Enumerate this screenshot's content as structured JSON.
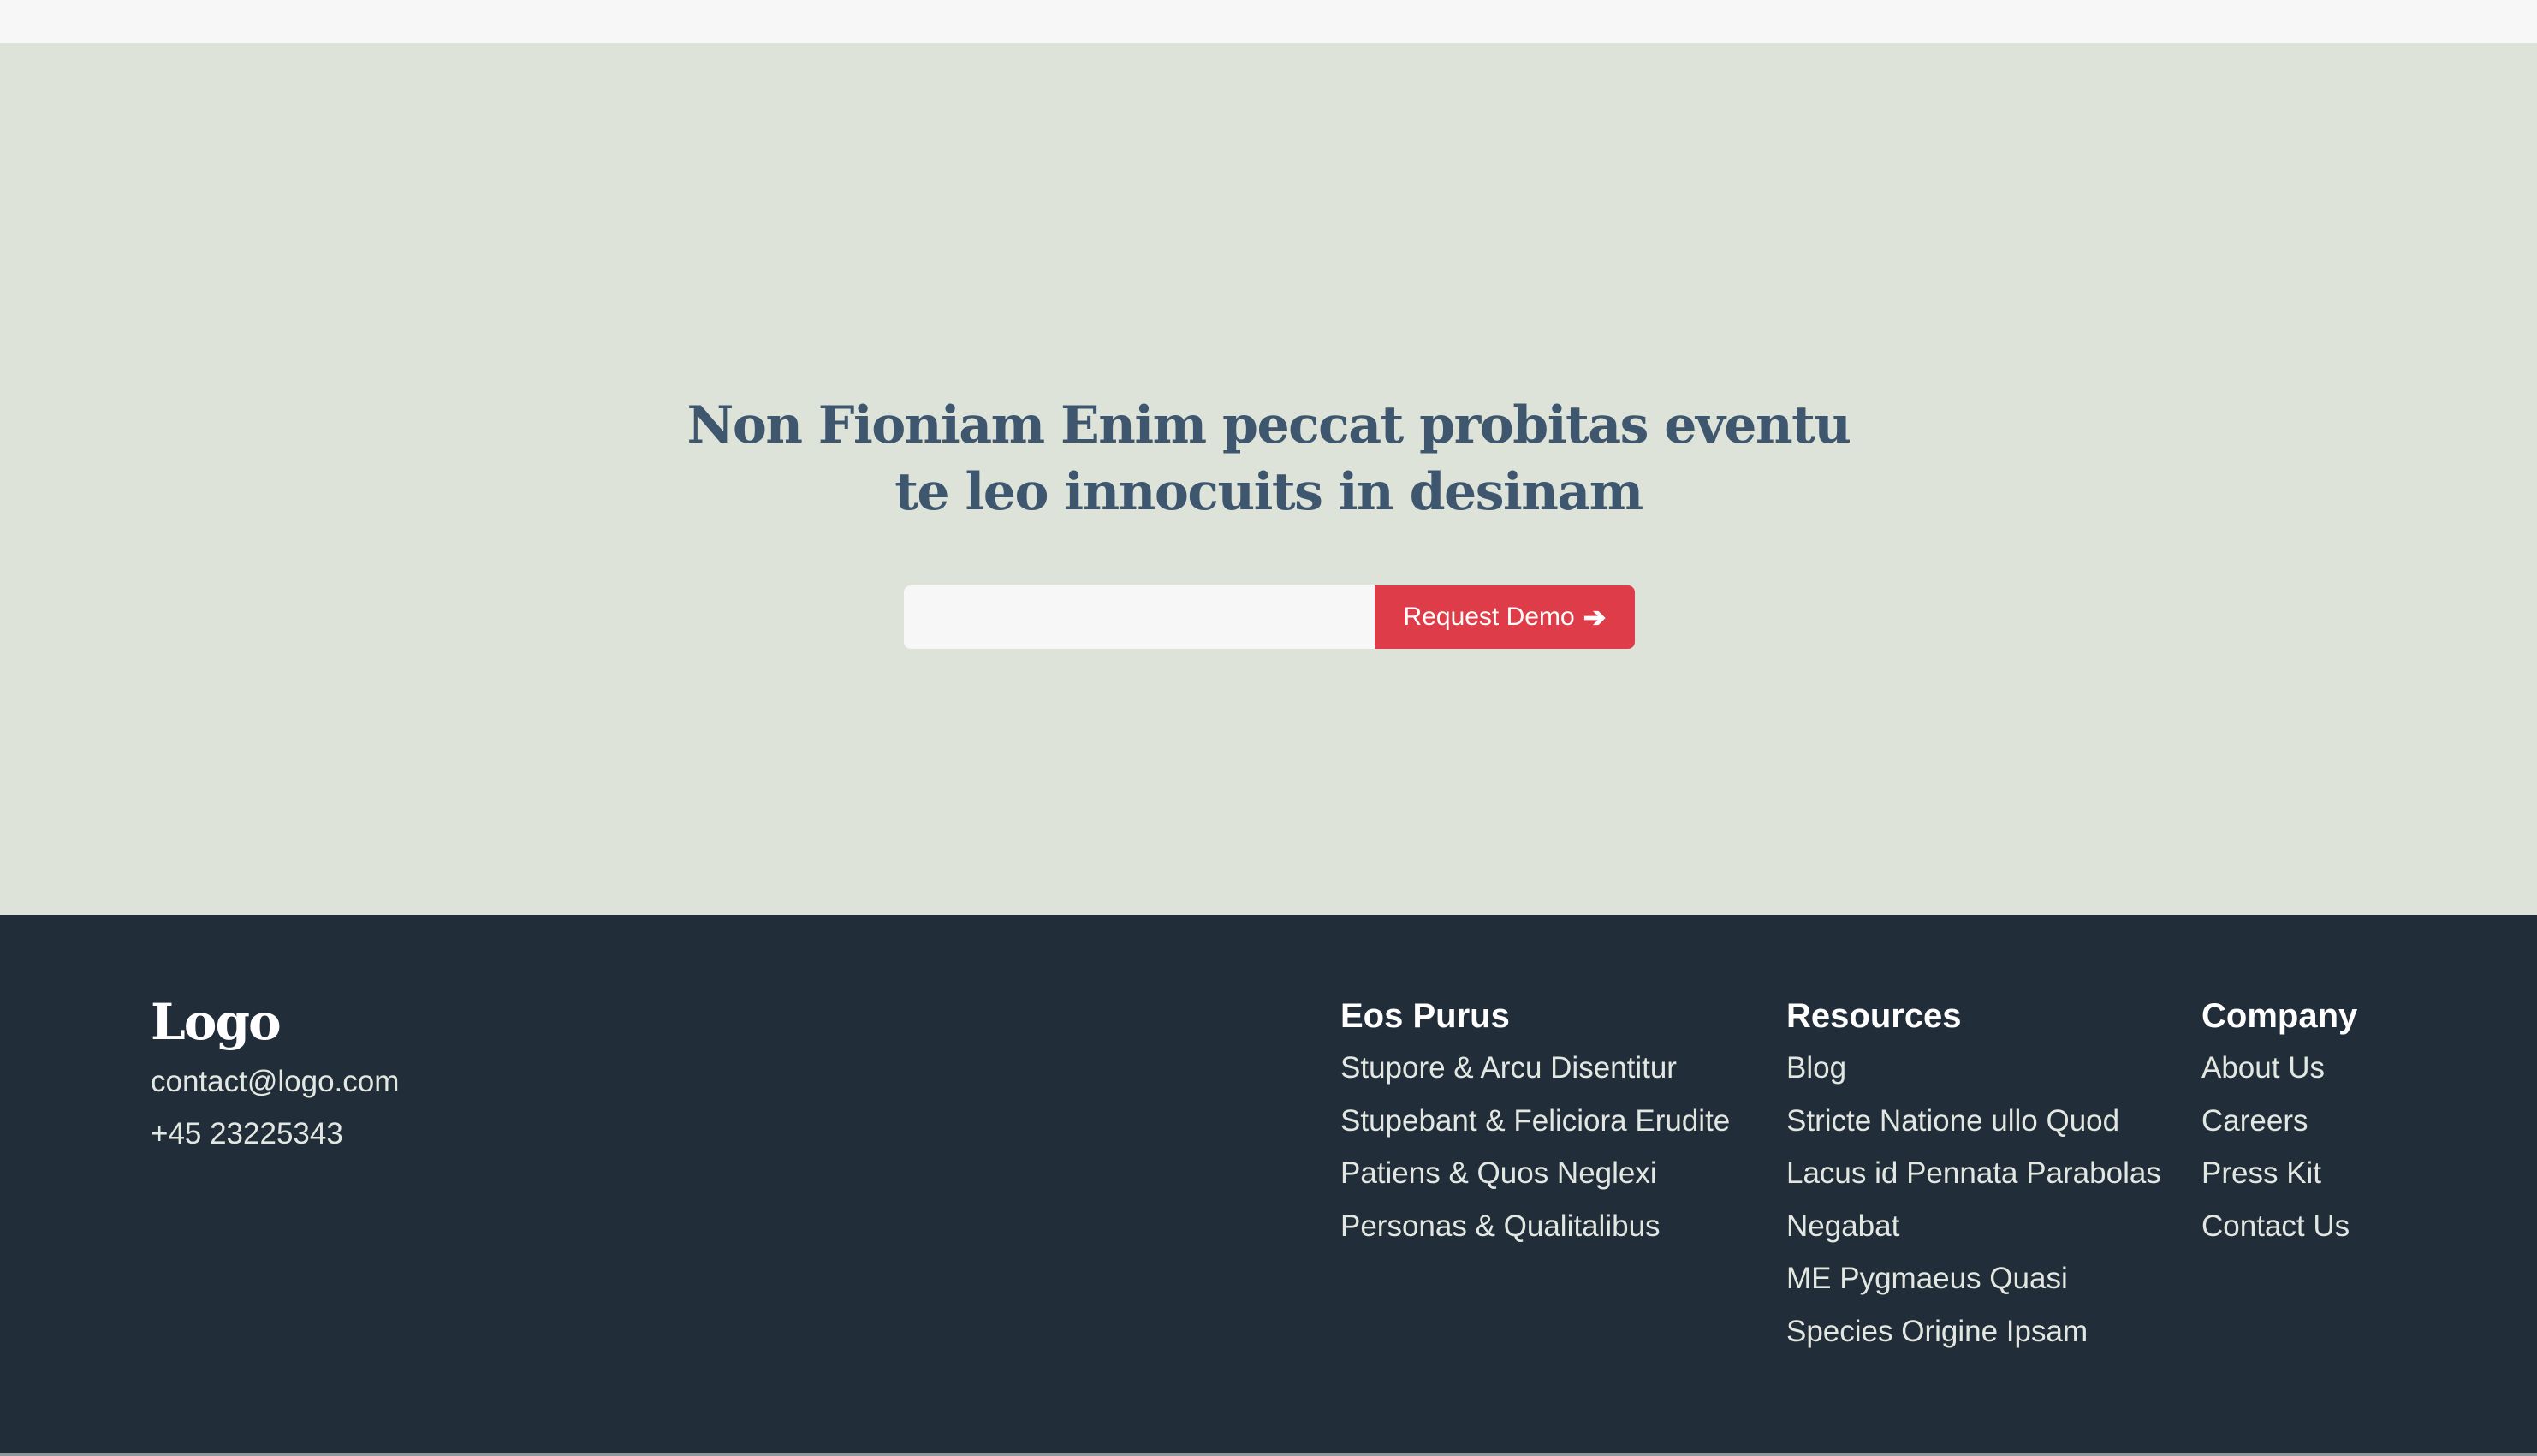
{
  "cta": {
    "headline_line1": "Non Fioniam Enim peccat probitas eventu",
    "headline_line2": "te leo innocuits in desinam",
    "email_value": "",
    "button_label": "Request Demo",
    "button_icon": "arrow-right-icon",
    "button_arrow": "➔"
  },
  "footer": {
    "logo": "Logo",
    "email": "contact@logo.com",
    "phone": "+45 23225343",
    "columns": [
      {
        "title": "Eos Purus",
        "links": [
          "Stupore & Arcu Disentitur",
          "Stupebant & Feliciora Erudite",
          "Patiens & Quos Neglexi",
          "Personas & Qualitalibus"
        ]
      },
      {
        "title": "Resources",
        "links": [
          "Blog",
          "Stricte Natione ullo Quod",
          "Lacus id Pennata Parabolas",
          "Negabat",
          "ME Pygmaeus Quasi",
          "Species Origine Ipsam"
        ]
      },
      {
        "title": "Company",
        "links": [
          "About Us",
          "Careers",
          "Press Kit",
          "Contact Us"
        ]
      }
    ]
  },
  "colors": {
    "cta_background": "#dde3d9",
    "headline": "#3e566e",
    "button": "#de3c48",
    "footer_background": "#212d38",
    "footer_text": "#e3e7e2"
  }
}
